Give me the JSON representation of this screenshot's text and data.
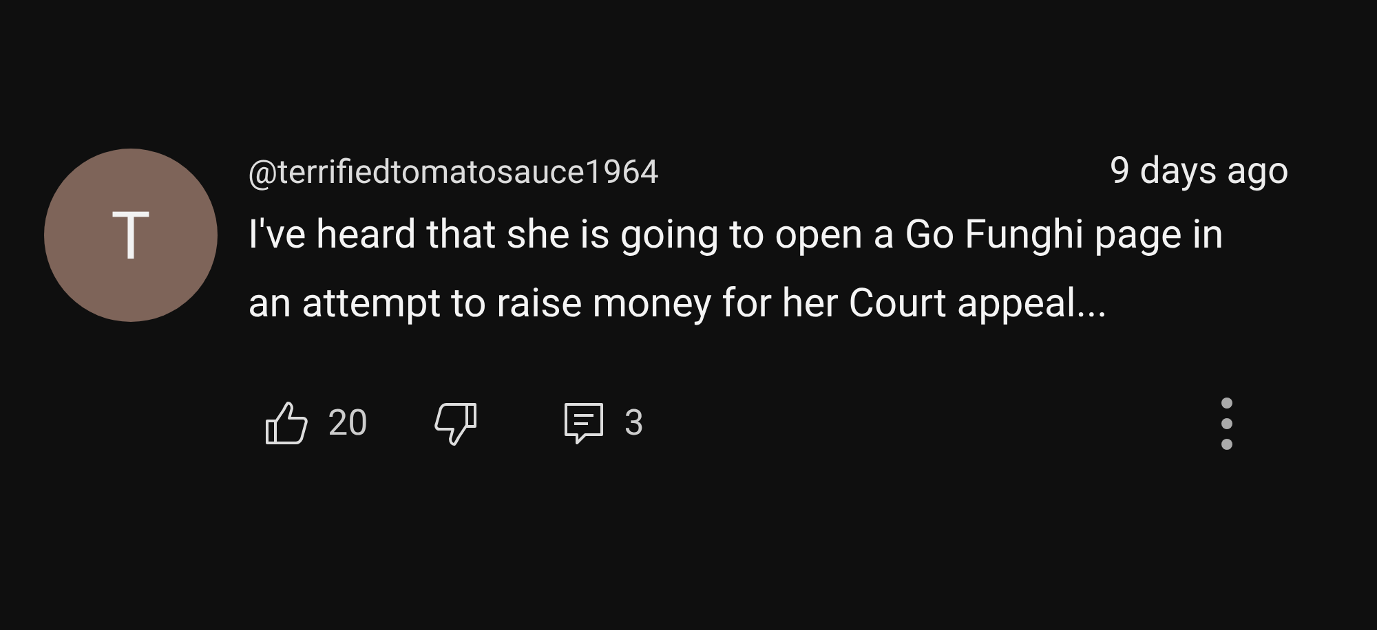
{
  "comment": {
    "avatar_letter": "T",
    "author": "@terrifiedtomatosauce1964",
    "time": "9 days ago",
    "text": "I've heard that she is going to open a Go Funghi page in an attempt to raise money for her Court appeal...",
    "likes": "20",
    "replies": "3"
  }
}
